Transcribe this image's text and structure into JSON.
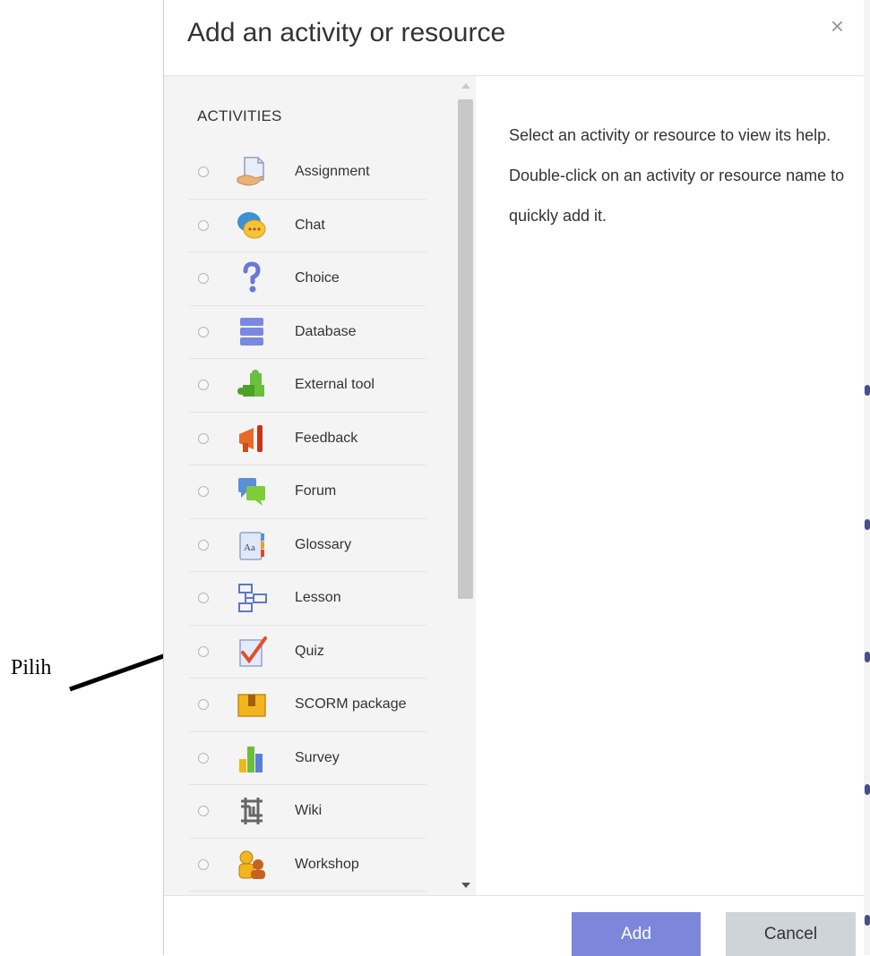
{
  "annotation": {
    "text": "Pilih"
  },
  "dialog": {
    "title": "Add an activity or resource",
    "close_symbol": "×",
    "section_label": "ACTIVITIES",
    "help_text": "Select an activity or resource to view its help. Double-click on an activity or resource name to quickly add it.",
    "items": [
      {
        "label": "Assignment",
        "icon": "assignment-icon"
      },
      {
        "label": "Chat",
        "icon": "chat-icon"
      },
      {
        "label": "Choice",
        "icon": "choice-icon"
      },
      {
        "label": "Database",
        "icon": "database-icon"
      },
      {
        "label": "External tool",
        "icon": "external-tool-icon"
      },
      {
        "label": "Feedback",
        "icon": "feedback-icon"
      },
      {
        "label": "Forum",
        "icon": "forum-icon"
      },
      {
        "label": "Glossary",
        "icon": "glossary-icon"
      },
      {
        "label": "Lesson",
        "icon": "lesson-icon"
      },
      {
        "label": "Quiz",
        "icon": "quiz-icon"
      },
      {
        "label": "SCORM package",
        "icon": "scorm-package-icon"
      },
      {
        "label": "Survey",
        "icon": "survey-icon"
      },
      {
        "label": "Wiki",
        "icon": "wiki-icon"
      },
      {
        "label": "Workshop",
        "icon": "workshop-icon"
      }
    ],
    "buttons": {
      "add": "Add",
      "cancel": "Cancel"
    },
    "colors": {
      "add_button": "#7c87db",
      "cancel_button": "#ced4da"
    }
  }
}
